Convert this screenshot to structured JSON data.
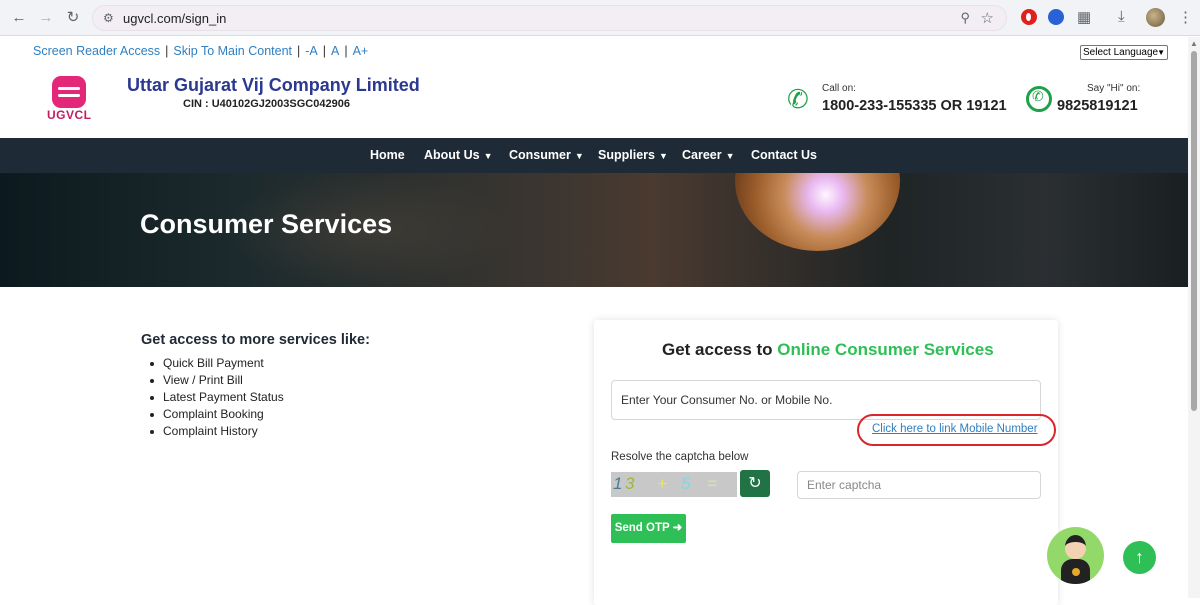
{
  "browser": {
    "url": "ugvcl.com/sign_in",
    "icons": [
      "back-icon",
      "forward-icon",
      "reload-icon",
      "site-settings-icon",
      "zoom-icon",
      "bookmark-star-icon",
      "opera-extension-icon",
      "extension-icon",
      "puzzle-icon",
      "download-icon",
      "profile-avatar",
      "menu-icon"
    ]
  },
  "accessibility": {
    "screen_reader": "Screen Reader Access",
    "skip_main": "Skip To Main Content",
    "font_decrease": "-A",
    "font_normal": "A",
    "font_increase": "A+",
    "separator": "|"
  },
  "language_select": {
    "value": "Select Language"
  },
  "header": {
    "logo_text": "UGVCL",
    "company_name": "Uttar Gujarat Vij Company Limited",
    "cin": "CIN : U40102GJ2003SGC042906",
    "call_label": "Call on:",
    "call_number": "1800-233-155335 OR 19121",
    "whatsapp_label": "Say \"Hi\" on:",
    "whatsapp_number": "9825819121"
  },
  "nav": {
    "items": [
      {
        "label": "Home",
        "has_dropdown": false
      },
      {
        "label": "About Us",
        "has_dropdown": true
      },
      {
        "label": "Consumer",
        "has_dropdown": true
      },
      {
        "label": "Suppliers",
        "has_dropdown": true
      },
      {
        "label": "Career",
        "has_dropdown": true
      },
      {
        "label": "Contact Us",
        "has_dropdown": false
      }
    ]
  },
  "hero": {
    "title": "Consumer Services"
  },
  "services": {
    "heading": "Get access to more services like:",
    "items": [
      "Quick Bill Payment",
      "View / Print Bill",
      "Latest Payment Status",
      "Complaint Booking",
      "Complaint History"
    ]
  },
  "login_card": {
    "title_prefix": "Get access to",
    "title_highlight": "Online Consumer Services",
    "consumer_placeholder": "Enter Your Consumer No. or Mobile No.",
    "link_mobile": "Click here to link Mobile Number",
    "captcha_label": "Resolve the captcha below",
    "captcha_chars": [
      "1",
      "3",
      "+",
      "5",
      "="
    ],
    "captcha_placeholder": "Enter captcha",
    "send_otp": "Send OTP"
  },
  "colors": {
    "accent_green": "#2fbf57",
    "nav_bg": "#1e2a35",
    "brand_navy": "#2b3990",
    "brand_pink": "#e3287a",
    "highlight_red": "#d9262c",
    "link_blue": "#2f7fc1"
  }
}
